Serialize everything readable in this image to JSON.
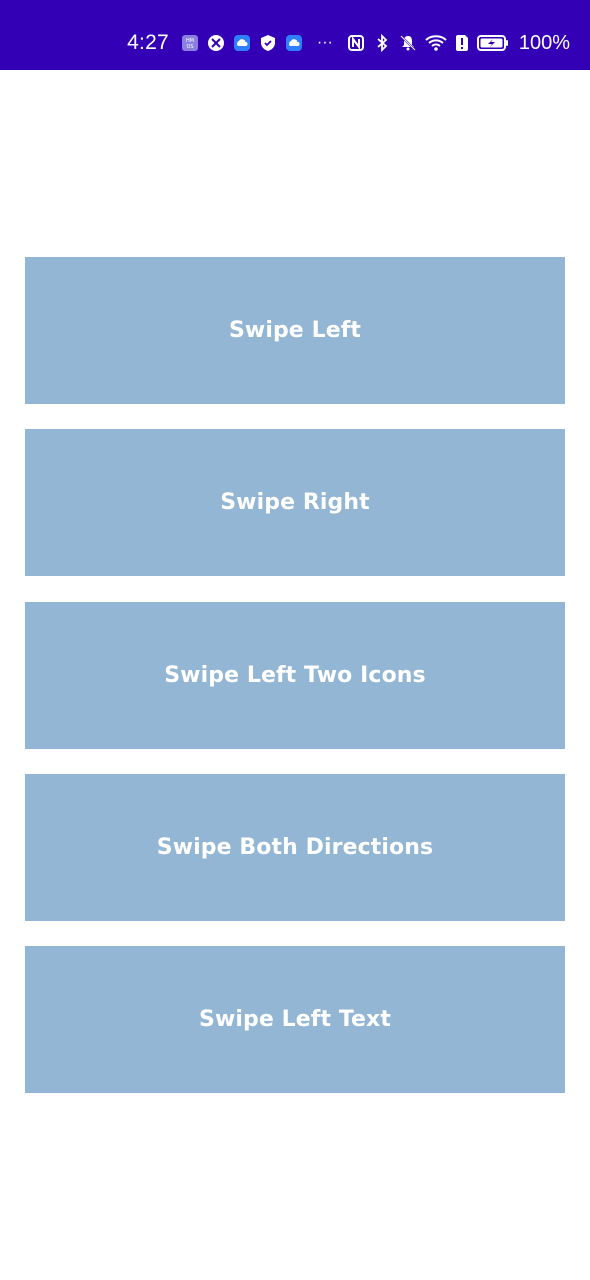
{
  "status_bar": {
    "time": "4:27",
    "battery_percent": "100%",
    "background": "#3300b5",
    "icons": [
      "hmos-icon",
      "app-icon",
      "cloud-icon",
      "shield-icon",
      "cloud-icon",
      "more-icon",
      "nfc-icon",
      "bluetooth-icon",
      "mute-icon",
      "wifi-icon",
      "sim-alert-icon",
      "battery-charging-icon"
    ],
    "more_label": "···"
  },
  "cards": [
    {
      "label": "Swipe Left"
    },
    {
      "label": "Swipe Right"
    },
    {
      "label": "Swipe Left Two Icons"
    },
    {
      "label": "Swipe Both Directions"
    },
    {
      "label": "Swipe Left Text"
    }
  ],
  "colors": {
    "card_background": "#92b6d3",
    "card_text": "#ffffff"
  }
}
